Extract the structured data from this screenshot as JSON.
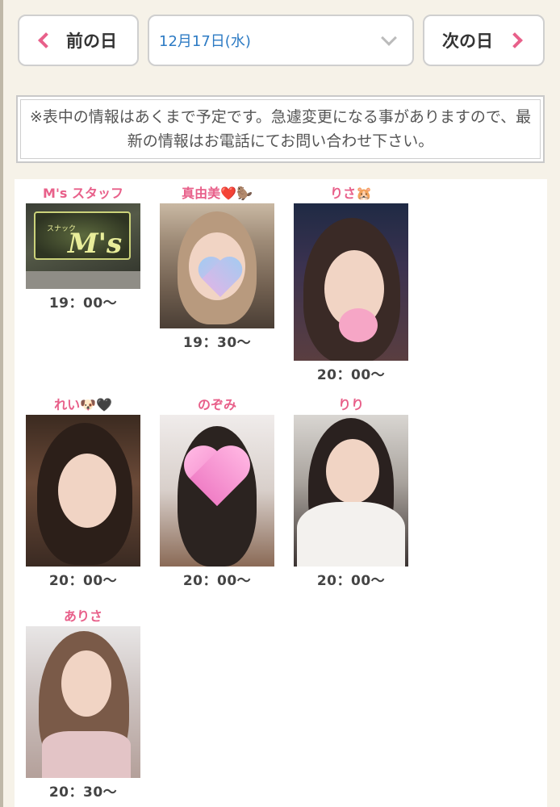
{
  "nav": {
    "prev_label": "前の日",
    "next_label": "次の日",
    "date_value": "12月17日(水)"
  },
  "notice": {
    "text": "※表中の情報はあくまで予定です。急遽変更になる事がありますので、最新の情報はお電話にてお問い合わせ下さい。"
  },
  "cast": [
    {
      "name": "M's スタッフ",
      "time": "19：00〜"
    },
    {
      "name": "真由美❤️🦫",
      "time": "19：30〜"
    },
    {
      "name": "りさ🐹",
      "time": "20：00〜"
    },
    {
      "name": "れい🐶🖤",
      "time": "20：00〜"
    },
    {
      "name": "のぞみ",
      "time": "20：00〜"
    },
    {
      "name": "りり",
      "time": "20：00〜"
    },
    {
      "name": "ありさ",
      "time": "20：30〜"
    }
  ],
  "sign": {
    "text": "M's",
    "small": "スナック"
  },
  "colors": {
    "accent": "#e8608a",
    "date_text": "#2d7bc4",
    "background": "#f6f2e8"
  }
}
